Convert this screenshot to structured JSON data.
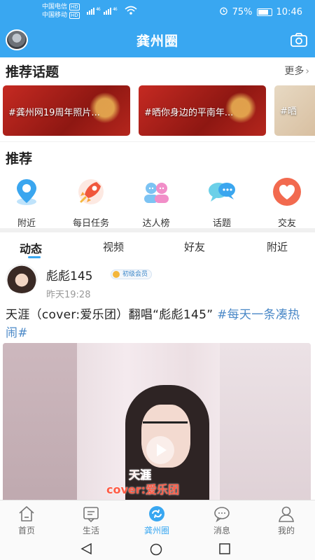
{
  "status_bar": {
    "carrier1": "中国电信",
    "carrier2": "中国移动",
    "hd": "HD",
    "signal": "⁴⁶ᴵᴵᴵ ⁴⁶ᴵᴵᴵ",
    "battery_text": "75%",
    "battery_level": 0.75,
    "time": "10:46"
  },
  "header": {
    "title": "龚州圈"
  },
  "topics_section": {
    "title": "推荐话题",
    "more": "更多",
    "items": [
      {
        "label": "#龚州网19周年照片..."
      },
      {
        "label": "#晒你身边的平南年..."
      },
      {
        "label": "#晒"
      }
    ]
  },
  "recommend_section": {
    "title": "推荐",
    "items": [
      {
        "label": "附近",
        "icon": "location-pin-icon"
      },
      {
        "label": "每日任务",
        "icon": "rocket-icon"
      },
      {
        "label": "达人榜",
        "icon": "people-icon"
      },
      {
        "label": "话题",
        "icon": "chat-bubbles-icon"
      },
      {
        "label": "交友",
        "icon": "heart-icon"
      }
    ]
  },
  "feed_tabs": {
    "items": [
      {
        "label": "动态",
        "active": true
      },
      {
        "label": "视频",
        "active": false
      },
      {
        "label": "好友",
        "active": false
      },
      {
        "label": "附近",
        "active": false
      }
    ]
  },
  "post": {
    "author": "彪彪145",
    "badge": "初级会员",
    "time": "昨天19:28",
    "text": "天涯（cover:爱乐团）翻唱“彪彪145”",
    "hashtag": "#每天一条凑热闹#",
    "video_subtitle_1": "天涯",
    "video_subtitle_2": "cover:爱乐团"
  },
  "bottom_nav": {
    "items": [
      {
        "label": "首页",
        "icon": "home-icon",
        "active": false
      },
      {
        "label": "生活",
        "icon": "life-icon",
        "active": false
      },
      {
        "label": "龚州圈",
        "icon": "circle-icon",
        "active": true
      },
      {
        "label": "消息",
        "icon": "message-icon",
        "active": false
      },
      {
        "label": "我的",
        "icon": "profile-icon",
        "active": false
      }
    ]
  },
  "colors": {
    "brand_blue": "#39a7f1",
    "hashtag": "#4a88c7"
  }
}
